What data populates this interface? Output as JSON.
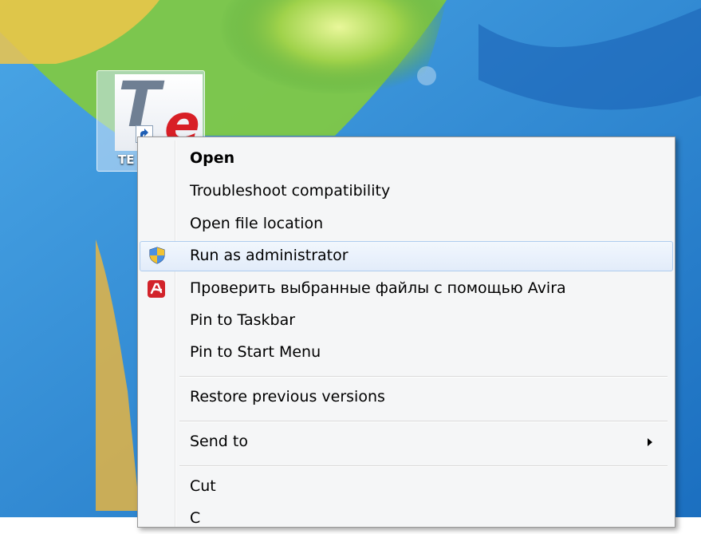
{
  "desktop": {
    "shortcut": {
      "label": "TE",
      "icon": "te-app-icon"
    }
  },
  "context_menu": {
    "items": [
      {
        "label": "Open"
      },
      {
        "label": "Troubleshoot compatibility"
      },
      {
        "label": "Open file location"
      },
      {
        "label": "Run as administrator",
        "icon": "uac-shield-icon"
      },
      {
        "label": "Проверить выбранные файлы с помощью Avira",
        "icon": "avira-icon"
      },
      {
        "label": "Pin to Taskbar"
      },
      {
        "label": "Pin to Start Menu"
      },
      {
        "label": "Restore previous versions"
      },
      {
        "label": "Send to",
        "icon": "submenu-arrow-icon"
      },
      {
        "label": "Cut"
      },
      {
        "label": "C"
      }
    ]
  },
  "colors": {
    "hover_border": "#aeccee",
    "avira_red": "#d2232a",
    "wallpaper_blue": "#2f8fd6"
  }
}
